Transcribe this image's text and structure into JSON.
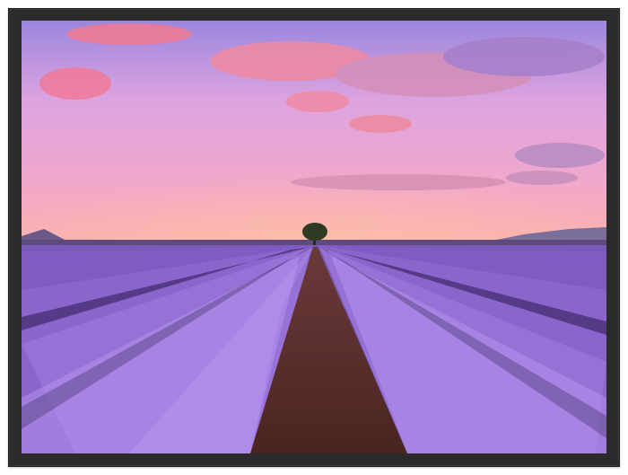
{
  "image": {
    "subject": "",
    "frame_color": "#2b2b2b",
    "colors": {
      "sky_top": "#8f7fdc",
      "sky_mid": "#e9a6d6",
      "sky_horizon": "#f7a7b9",
      "cloud": "#f07c96",
      "lavender_light": "#a97de0",
      "lavender_dark": "#5a3e9c",
      "soil": "#4a2a24"
    }
  }
}
